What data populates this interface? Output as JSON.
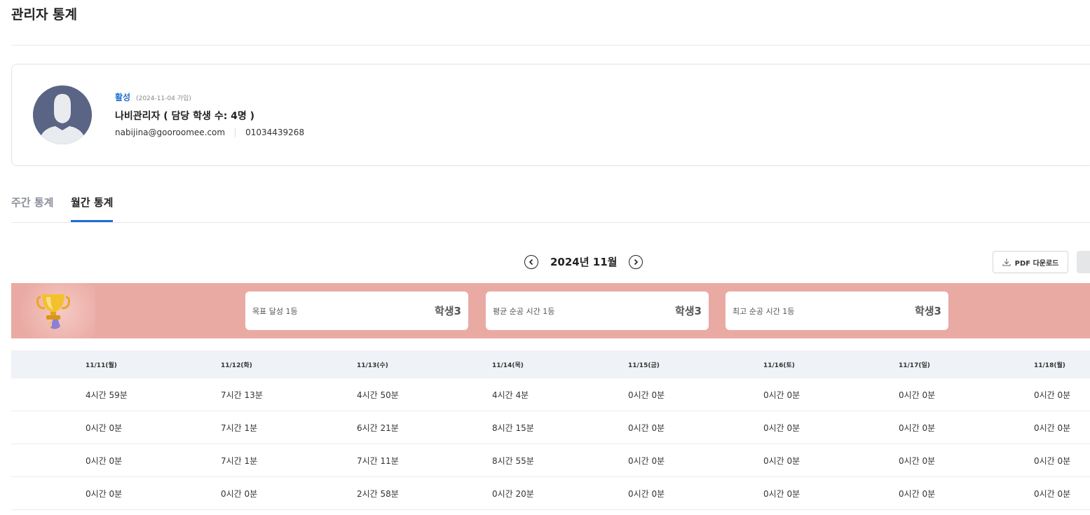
{
  "page": {
    "title": "관리자 통계"
  },
  "profile": {
    "status": "활성",
    "join_date": "(2024-11-04 가입)",
    "name": "나비관리자 ( 담당 학생 수: 4명 )",
    "email": "nabijina@gooroomee.com",
    "phone": "01034439268"
  },
  "tabs": [
    {
      "label": "주간 통계",
      "active": false
    },
    {
      "label": "월간 통계",
      "active": true
    }
  ],
  "month_nav": {
    "label": "2024년 11월"
  },
  "pdf_download": {
    "label": "PDF 다운로드"
  },
  "rankings": [
    {
      "label": "목표 달성 1등",
      "value": "학생3"
    },
    {
      "label": "평균 순공 시간 1등",
      "value": "학생3"
    },
    {
      "label": "최고 순공 시간 1등",
      "value": "학생3"
    }
  ],
  "table": {
    "headers": [
      "11/11(월)",
      "11/12(화)",
      "11/13(수)",
      "11/14(목)",
      "11/15(금)",
      "11/16(토)",
      "11/17(일)",
      "11/18(월)"
    ],
    "rows": [
      [
        "4시간 59분",
        "7시간 13분",
        "4시간 50분",
        "4시간 4분",
        "0시간 0분",
        "0시간 0분",
        "0시간 0분",
        "0시간 0분"
      ],
      [
        "0시간 0분",
        "7시간 1분",
        "6시간 21분",
        "8시간 15분",
        "0시간 0분",
        "0시간 0분",
        "0시간 0분",
        "0시간 0분"
      ],
      [
        "0시간 0분",
        "7시간 1분",
        "7시간 11분",
        "8시간 55분",
        "0시간 0분",
        "0시간 0분",
        "0시간 0분",
        "0시간 0분"
      ],
      [
        "0시간 0분",
        "0시간 0분",
        "2시간 58분",
        "0시간 20분",
        "0시간 0분",
        "0시간 0분",
        "0시간 0분",
        "0시간 0분"
      ]
    ]
  },
  "colors": {
    "accent": "#1f6fcf",
    "banner": "#eaaaa4",
    "table_header_bg": "#eff2f6"
  },
  "icons": {
    "avatar": "person-silhouette-icon",
    "prev": "chevron-left-circle-icon",
    "next": "chevron-right-circle-icon",
    "pdf": "download-icon",
    "banner": "trophy-icon"
  }
}
